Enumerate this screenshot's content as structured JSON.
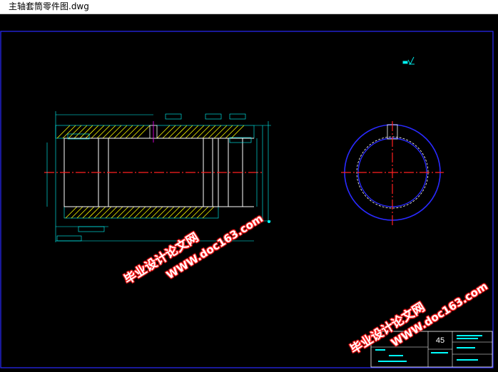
{
  "window": {
    "title": "主轴套筒零件图.dwg"
  },
  "drawing": {
    "title_block": {
      "material": "45"
    },
    "watermark": {
      "site_name": "毕业设计论文网",
      "url": "WWW.doc163.com"
    }
  }
}
